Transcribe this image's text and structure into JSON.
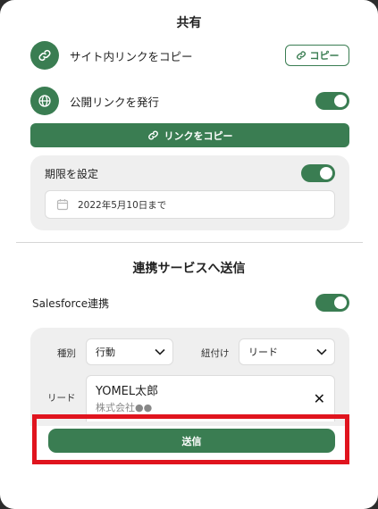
{
  "share": {
    "title": "共有",
    "site_link_label": "サイト内リンクをコピー",
    "copy_button_label": "コピー",
    "public_link_label": "公開リンクを発行",
    "copy_link_button_label": "リンクをコピー",
    "public_link_enabled": true,
    "expiry": {
      "label": "期限を設定",
      "enabled": true,
      "date_value": "2022年5月10日まで"
    }
  },
  "integration": {
    "title": "連携サービスへ送信",
    "salesforce_label": "Salesforce連携",
    "salesforce_enabled": true,
    "type_label": "種別",
    "type_value": "行動",
    "link_label": "紐付け",
    "link_value": "リード",
    "lead_label": "リード",
    "lead_name": "YOMEL太郎",
    "lead_company": "株式会社●●",
    "send_button_label": "送信"
  },
  "colors": {
    "accent": "#3a7d52",
    "highlight": "#e0141e"
  },
  "icons": [
    "link-icon",
    "globe-icon",
    "calendar-icon",
    "chevron-down-icon",
    "close-icon"
  ]
}
